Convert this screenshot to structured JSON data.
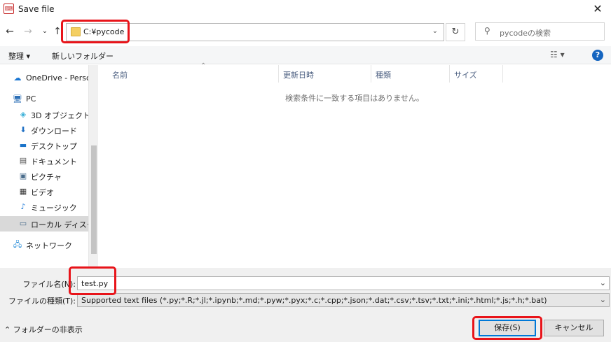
{
  "window": {
    "title": "Save file",
    "close_glyph": "✕"
  },
  "nav": {
    "back": "←",
    "forward": "→",
    "recent": "⌄",
    "up": "↑",
    "refresh": "↻"
  },
  "address": {
    "path": "C:¥pycode"
  },
  "search": {
    "placeholder": "pycodeの検索"
  },
  "toolbar": {
    "organize": "整理 ▾",
    "new_folder": "新しいフォルダー",
    "view": "☷ ▾",
    "help": "?"
  },
  "sidebar": {
    "items": [
      {
        "label": "OneDrive - Persor",
        "icon": "cloud-icon"
      },
      {
        "label": "PC",
        "icon": "computer-icon"
      },
      {
        "label": "3D オブジェクト",
        "icon": "cube-icon"
      },
      {
        "label": "ダウンロード",
        "icon": "download-icon"
      },
      {
        "label": "デスクトップ",
        "icon": "desktop-icon"
      },
      {
        "label": "ドキュメント",
        "icon": "document-icon"
      },
      {
        "label": "ピクチャ",
        "icon": "picture-icon"
      },
      {
        "label": "ビデオ",
        "icon": "video-icon"
      },
      {
        "label": "ミュージック",
        "icon": "music-icon"
      },
      {
        "label": "ローカル ディスク (C",
        "icon": "drive-icon"
      },
      {
        "label": "ネットワーク",
        "icon": "network-icon"
      }
    ]
  },
  "list": {
    "columns": [
      "名前",
      "更新日時",
      "種類",
      "サイズ"
    ],
    "empty_message": "検索条件に一致する項目はありません。"
  },
  "form": {
    "filename_label": "ファイル名(N):",
    "filename_value": "test.py",
    "filetype_label": "ファイルの種類(T):",
    "filetype_value": "Supported text files (*.py;*.R;*.jl;*.ipynb;*.md;*.pyw;*.pyx;*.c;*.cpp;*.json;*.dat;*.csv;*.tsv;*.txt;*.ini;*.html;*.js;*.h;*.bat)"
  },
  "footer": {
    "hide_folders": "⌃ フォルダーの非表示",
    "save": "保存(S)",
    "cancel": "キャンセル"
  },
  "colors": {
    "highlight": "#e8141a",
    "primary_border": "#0078d7",
    "folder": "#f4cf62"
  }
}
